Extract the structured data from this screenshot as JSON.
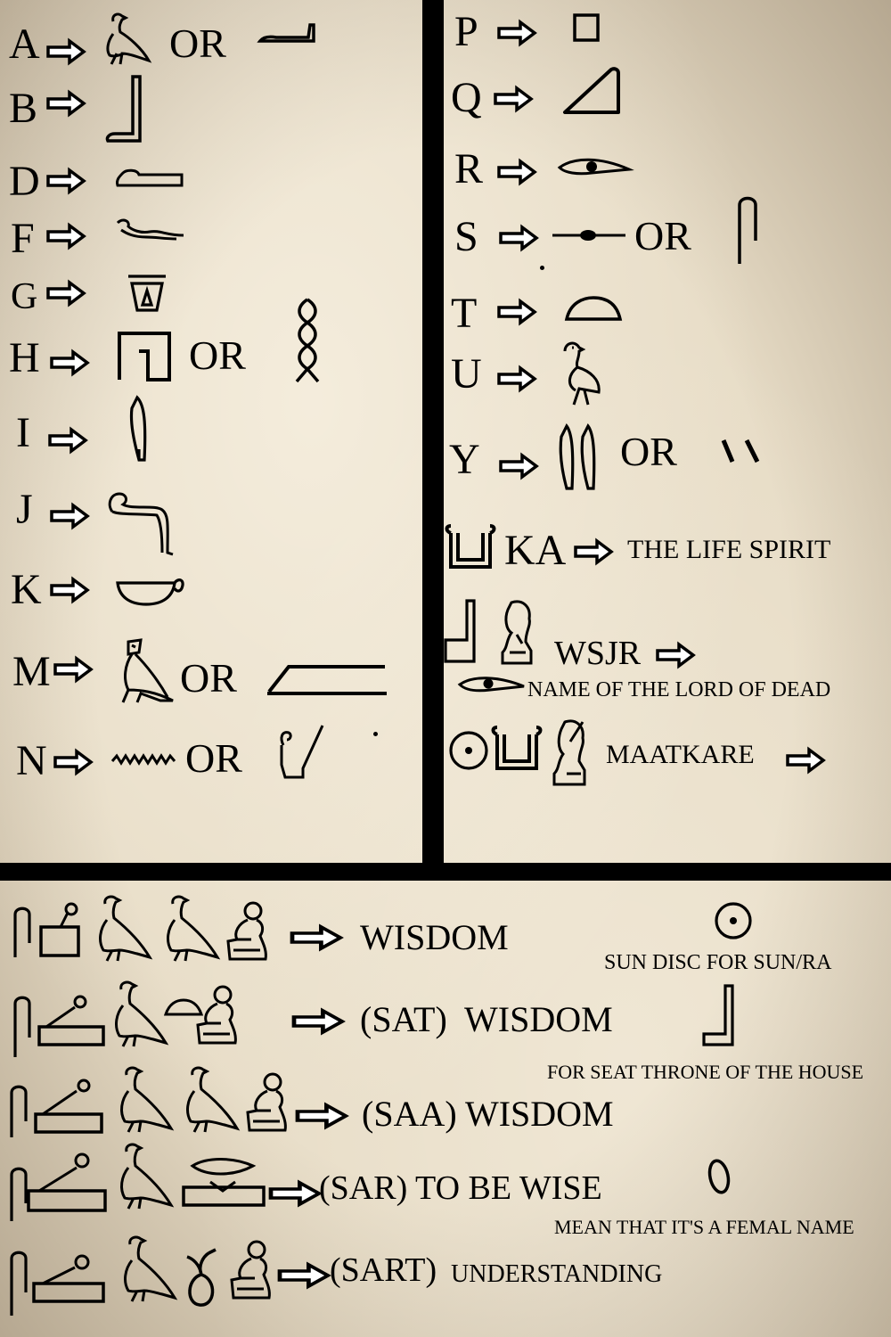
{
  "alphabet_left": [
    {
      "letter": "A",
      "or": "OR"
    },
    {
      "letter": "B"
    },
    {
      "letter": "D"
    },
    {
      "letter": "F"
    },
    {
      "letter": "G"
    },
    {
      "letter": "H",
      "or": "OR"
    },
    {
      "letter": "I"
    },
    {
      "letter": "J"
    },
    {
      "letter": "K"
    },
    {
      "letter": "M",
      "or": "OR"
    },
    {
      "letter": "N",
      "or": "OR"
    }
  ],
  "alphabet_right": [
    {
      "letter": "P"
    },
    {
      "letter": "Q"
    },
    {
      "letter": "R"
    },
    {
      "letter": "S",
      "or": "OR"
    },
    {
      "letter": "T"
    },
    {
      "letter": "U"
    },
    {
      "letter": "Y",
      "or": "OR"
    }
  ],
  "words": {
    "ka": "KA",
    "ka_meaning": "THE LIFE SPIRIT",
    "wsjr": "WSJR",
    "wsjr_meaning": "NAME OF THE LORD OF DEAD",
    "maatkare": "MAATKARE"
  },
  "phrases": [
    {
      "text": "WISDOM"
    },
    {
      "text": "(SAT)  WISDOM"
    },
    {
      "text": "(SAA) WISDOM"
    },
    {
      "text": "(SAR) TO BE WISE"
    },
    {
      "text": "(SART)",
      "text2": "UNDERSTANDING"
    }
  ],
  "notes": {
    "sun": "SUN DISC FOR SUN/RA",
    "seat": "FOR SEAT THRONE OF THE HOUSE",
    "female": "MEAN THAT IT'S A FEMAL NAME"
  },
  "icons": [
    "vulture-icon",
    "reed-leaf-icon",
    "foot-icon",
    "hand-icon",
    "horned-viper-icon",
    "jar-stand-icon",
    "courtyard-icon",
    "twisted-flax-icon",
    "cobra-icon",
    "basket-icon",
    "owl-icon",
    "water-icon",
    "crown-icon",
    "stool-icon",
    "hill-slope-icon",
    "mouth-eye-icon",
    "door-bolt-icon",
    "folded-cloth-icon",
    "bread-loaf-icon",
    "quail-chick-icon",
    "double-reed-icon",
    "diagonal-strokes-icon",
    "ka-arms-icon",
    "throne-icon",
    "seated-god-icon",
    "sun-disc-icon",
    "seated-woman-icon",
    "seated-man-icon",
    "folded-cloth-with-bar-icon",
    "mat-with-pin-icon",
    "lashing-icon",
    "egg-icon",
    "thread-loop-icon"
  ]
}
